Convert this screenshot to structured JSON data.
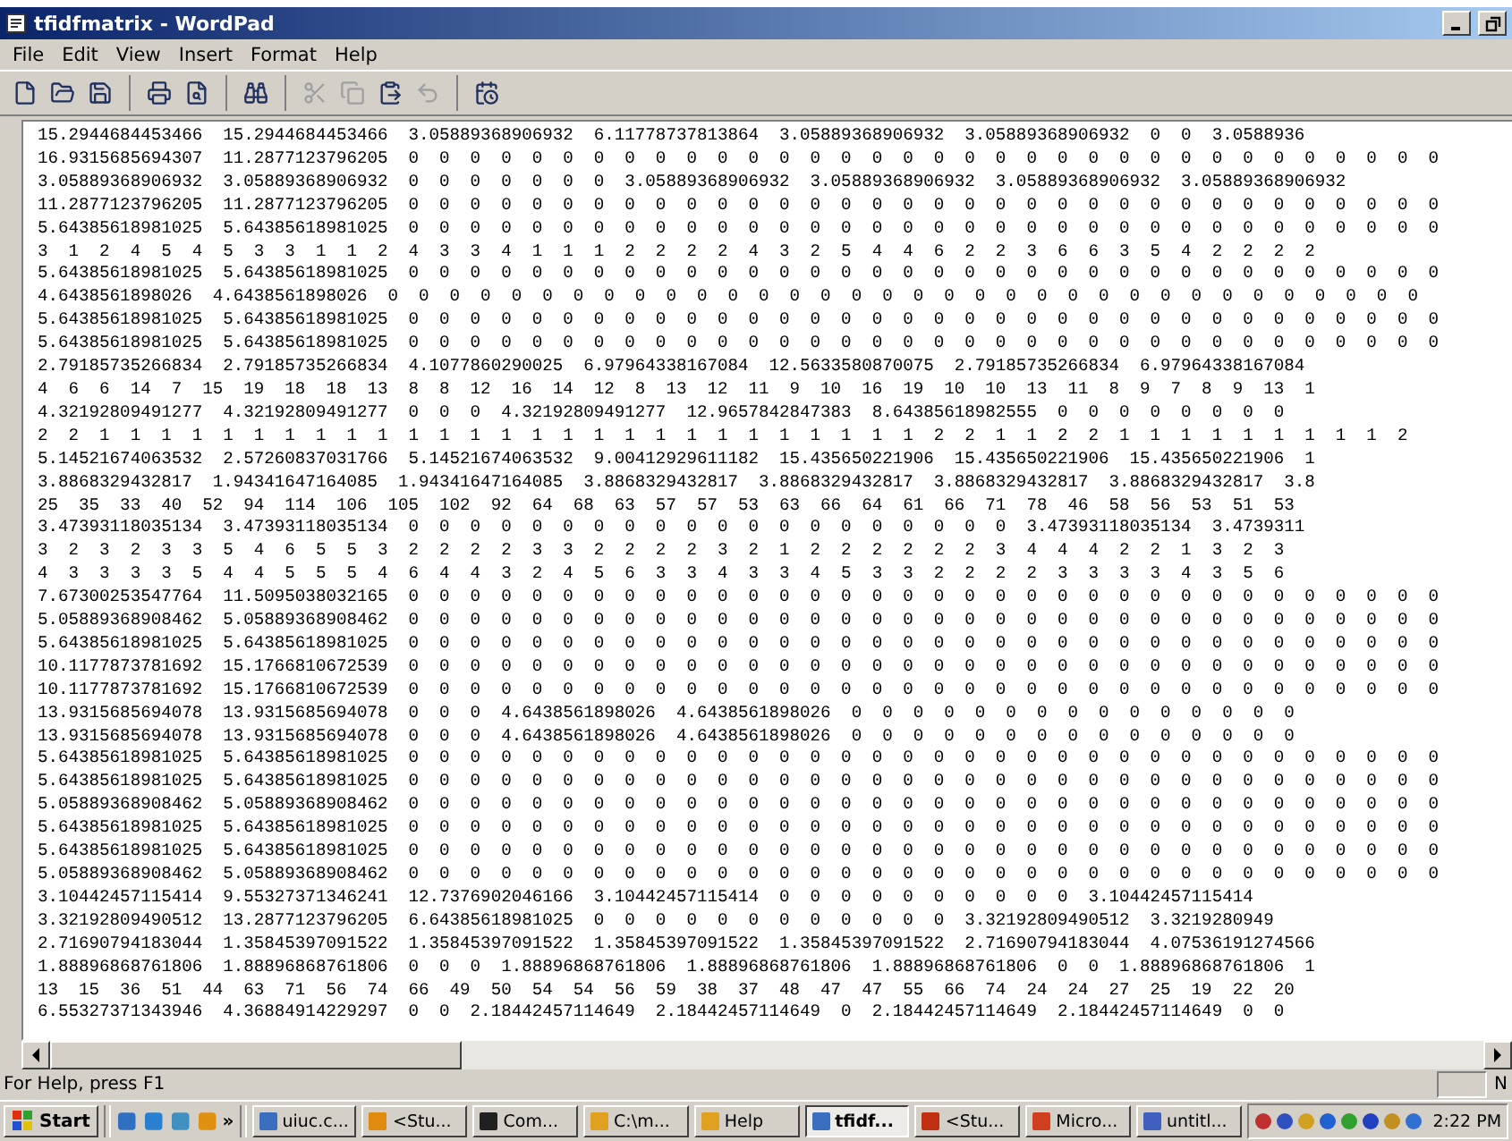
{
  "window": {
    "title": "tfidfmatrix - WordPad"
  },
  "menu": [
    "File",
    "Edit",
    "View",
    "Insert",
    "Format",
    "Help"
  ],
  "toolbar": {
    "groups": [
      [
        {
          "disabled": false
        },
        {
          "disabled": false
        },
        {
          "disabled": false
        }
      ],
      [
        {
          "disabled": false
        },
        {
          "disabled": false
        }
      ],
      [
        {
          "disabled": false
        }
      ],
      [
        {
          "disabled": true
        },
        {
          "disabled": true
        },
        {
          "disabled": false
        },
        {
          "disabled": true
        }
      ],
      [
        {
          "disabled": false
        }
      ]
    ]
  },
  "document": {
    "lines": [
      "15.2944684453466  15.2944684453466  3.05889368906932  6.11778737813864  3.05889368906932  3.05889368906932  0  0  3.0588936",
      "16.9315685694307  11.2877123796205  0  0  0  0  0  0  0  0  0  0  0  0  0  0  0  0  0  0  0  0  0  0  0  0  0  0  0  0  0  0  0  0  0  0",
      "3.05889368906932  3.05889368906932  0  0  0  0  0  0  0  3.05889368906932  3.05889368906932  3.05889368906932  3.05889368906932",
      "11.2877123796205  11.2877123796205  0  0  0  0  0  0  0  0  0  0  0  0  0  0  0  0  0  0  0  0  0  0  0  0  0  0  0  0  0  0  0  0  0  0",
      "5.64385618981025  5.64385618981025  0  0  0  0  0  0  0  0  0  0  0  0  0  0  0  0  0  0  0  0  0  0  0  0  0  0  0  0  0  0  0  0  0  0",
      "3  1  2  4  5  4  5  3  3  1  1  2  4  3  3  4  1  1  1  2  2  2  2  4  3  2  5  4  4  6  2  2  3  6  6  3  5  4  2  2  2  2",
      "5.64385618981025  5.64385618981025  0  0  0  0  0  0  0  0  0  0  0  0  0  0  0  0  0  0  0  0  0  0  0  0  0  0  0  0  0  0  0  0  0  0",
      "4.6438561898026  4.6438561898026  0  0  0  0  0  0  0  0  0  0  0  0  0  0  0  0  0  0  0  0  0  0  0  0  0  0  0  0  0  0  0  0  0  0",
      "5.64385618981025  5.64385618981025  0  0  0  0  0  0  0  0  0  0  0  0  0  0  0  0  0  0  0  0  0  0  0  0  0  0  0  0  0  0  0  0  0  0",
      "5.64385618981025  5.64385618981025  0  0  0  0  0  0  0  0  0  0  0  0  0  0  0  0  0  0  0  0  0  0  0  0  0  0  0  0  0  0  0  0  0  0",
      "2.79185735266834  2.79185735266834  4.1077860290025  6.97964338167084  12.5633580870075  2.79185735266834  6.97964338167084",
      "4  6  6  14  7  15  19  18  18  13  8  8  12  16  14  12  8  13  12  11  9  10  16  19  10  10  13  11  8  9  7  8  9  13  1",
      "4.32192809491277  4.32192809491277  0  0  0  4.32192809491277  12.9657842847383  8.64385618982555  0  0  0  0  0  0  0  0",
      "2  2  1  1  1  1  1  1  1  1  1  1  1  1  1  1  1  1  1  1  1  1  1  1  1  1  1  1  1  2  2  1  1  2  2  1  1  1  1  1  1  1  1  1  2",
      "5.14521674063532  2.57260837031766  5.14521674063532  9.00412929611182  15.435650221906  15.435650221906  15.435650221906  1",
      "3.8868329432817  1.94341647164085  1.94341647164085  3.8868329432817  3.8868329432817  3.8868329432817  3.8868329432817  3.8",
      "25  35  33  40  52  94  114  106  105  102  92  64  68  63  57  57  53  63  66  64  61  66  71  78  46  58  56  53  51  53",
      "3.47393118035134  3.47393118035134  0  0  0  0  0  0  0  0  0  0  0  0  0  0  0  0  0  0  0  0  3.47393118035134  3.4739311",
      "3  2  3  2  3  3  5  4  6  5  5  3  2  2  2  2  3  3  2  2  2  2  3  2  1  2  2  2  2  2  2  3  4  4  4  2  2  1  3  2  3",
      "4  3  3  3  3  5  4  4  5  5  5  4  6  4  4  3  2  4  5  6  3  3  4  3  3  4  5  3  3  2  2  2  2  3  3  3  3  4  3  5  6",
      "7.67300253547764  11.5095038032165  0  0  0  0  0  0  0  0  0  0  0  0  0  0  0  0  0  0  0  0  0  0  0  0  0  0  0  0  0  0  0  0  0  0",
      "5.05889368908462  5.05889368908462  0  0  0  0  0  0  0  0  0  0  0  0  0  0  0  0  0  0  0  0  0  0  0  0  0  0  0  0  0  0  0  0  0  0",
      "5.64385618981025  5.64385618981025  0  0  0  0  0  0  0  0  0  0  0  0  0  0  0  0  0  0  0  0  0  0  0  0  0  0  0  0  0  0  0  0  0  0",
      "10.1177873781692  15.1766810672539  0  0  0  0  0  0  0  0  0  0  0  0  0  0  0  0  0  0  0  0  0  0  0  0  0  0  0  0  0  0  0  0  0  0",
      "10.1177873781692  15.1766810672539  0  0  0  0  0  0  0  0  0  0  0  0  0  0  0  0  0  0  0  0  0  0  0  0  0  0  0  0  0  0  0  0  0  0",
      "13.9315685694078  13.9315685694078  0  0  0  4.6438561898026  4.6438561898026  0  0  0  0  0  0  0  0  0  0  0  0  0  0  0",
      "13.9315685694078  13.9315685694078  0  0  0  4.6438561898026  4.6438561898026  0  0  0  0  0  0  0  0  0  0  0  0  0  0  0",
      "5.64385618981025  5.64385618981025  0  0  0  0  0  0  0  0  0  0  0  0  0  0  0  0  0  0  0  0  0  0  0  0  0  0  0  0  0  0  0  0  0  0",
      "5.64385618981025  5.64385618981025  0  0  0  0  0  0  0  0  0  0  0  0  0  0  0  0  0  0  0  0  0  0  0  0  0  0  0  0  0  0  0  0  0  0",
      "5.05889368908462  5.05889368908462  0  0  0  0  0  0  0  0  0  0  0  0  0  0  0  0  0  0  0  0  0  0  0  0  0  0  0  0  0  0  0  0  0  0",
      "5.64385618981025  5.64385618981025  0  0  0  0  0  0  0  0  0  0  0  0  0  0  0  0  0  0  0  0  0  0  0  0  0  0  0  0  0  0  0  0  0  0",
      "5.64385618981025  5.64385618981025  0  0  0  0  0  0  0  0  0  0  0  0  0  0  0  0  0  0  0  0  0  0  0  0  0  0  0  0  0  0  0  0  0  0",
      "5.05889368908462  5.05889368908462  0  0  0  0  0  0  0  0  0  0  0  0  0  0  0  0  0  0  0  0  0  0  0  0  0  0  0  0  0  0  0  0  0  0",
      "3.10442457115414  9.55327371346241  12.7376902046166  3.10442457115414  0  0  0  0  0  0  0  0  0  0  3.10442457115414",
      "3.32192809490512  13.2877123796205  6.64385618981025  0  0  0  0  0  0  0  0  0  0  0  0  3.32192809490512  3.3219280949",
      "2.71690794183044  1.35845397091522  1.35845397091522  1.35845397091522  1.35845397091522  2.71690794183044  4.07536191274566",
      "1.88896868761806  1.88896868761806  0  0  0  1.88896868761806  1.88896868761806  1.88896868761806  0  0  1.88896868761806  1",
      "13  15  36  51  44  63  71  56  74  66  49  50  54  54  56  59  38  37  48  47  47  55  66  74  24  24  27  25  19  22  20",
      "6.55327371343946  4.36884914229297  0  0  2.18442457114649  2.18442457114649  0  2.18442457114649  2.18442457114649  0  0"
    ]
  },
  "status_bar": {
    "text": "For Help, press F1",
    "indicator": "N"
  },
  "taskbar": {
    "start": "Start",
    "more": "»",
    "tasks": [
      {
        "label": "uiuc.c...",
        "selected": false
      },
      {
        "label": "<Stu...",
        "selected": false
      },
      {
        "label": "Com...",
        "selected": false
      },
      {
        "label": "C:\\m...",
        "selected": false
      },
      {
        "label": "Help",
        "selected": false
      },
      {
        "label": "tfidf...",
        "selected": true
      },
      {
        "label": "<Stu...",
        "selected": false
      },
      {
        "label": "Micro...",
        "selected": false
      },
      {
        "label": "untitl...",
        "selected": false
      }
    ],
    "clock": "2:22 PM"
  }
}
